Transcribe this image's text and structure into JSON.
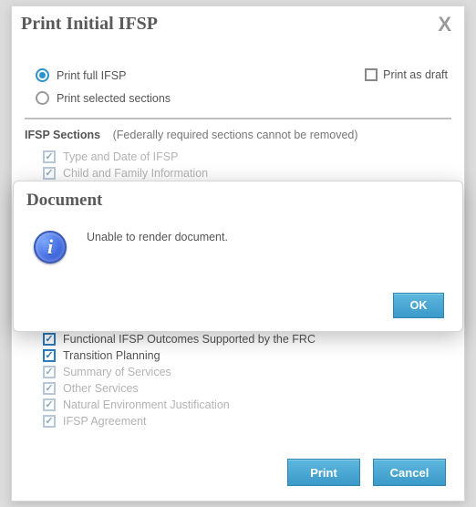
{
  "dialog": {
    "title": "Print Initial IFSP",
    "radios": {
      "full": "Print full IFSP",
      "selected": "Print selected sections"
    },
    "draft_label": "Print as draft",
    "sections_header": "IFSP Sections",
    "sections_note": "(Federally required sections cannot be removed)",
    "sections": [
      {
        "label": "Type and Date of IFSP",
        "enabled": false
      },
      {
        "label": "Child and Family Information",
        "enabled": false
      },
      {
        "label": "Functional IFSP Outcomes Supported by the FRC",
        "enabled": true
      },
      {
        "label": "Transition Planning",
        "enabled": true
      },
      {
        "label": "Summary of Services",
        "enabled": false
      },
      {
        "label": "Other Services",
        "enabled": false
      },
      {
        "label": "Natural Environment Justification",
        "enabled": false
      },
      {
        "label": "IFSP Agreement",
        "enabled": false
      }
    ],
    "buttons": {
      "print": "Print",
      "cancel": "Cancel"
    }
  },
  "modal": {
    "title": "Document",
    "message": "Unable to render document.",
    "ok": "OK"
  }
}
